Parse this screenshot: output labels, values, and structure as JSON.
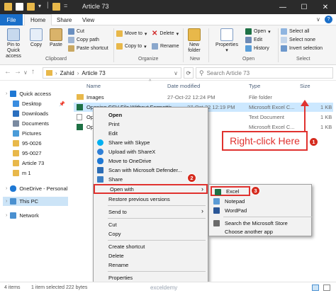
{
  "window": {
    "title": "Article 73",
    "controls": {
      "minimize": "—",
      "maximize": "☐",
      "close": "✕"
    }
  },
  "ribbon_tabs": [
    "File",
    "Home",
    "Share",
    "View"
  ],
  "ribbon": {
    "clipboard": {
      "pin": "Pin to Quick access",
      "copy": "Copy",
      "paste": "Paste",
      "cut": "Cut",
      "copy_path": "Copy path",
      "paste_shortcut": "Paste shortcut",
      "label": "Clipboard"
    },
    "organize": {
      "move_to": "Move to",
      "copy_to": "Copy to",
      "delete": "Delete",
      "rename": "Rename",
      "label": "Organize"
    },
    "new": {
      "new_folder": "New folder",
      "label": "New"
    },
    "open": {
      "properties": "Properties",
      "open": "Open",
      "edit": "Edit",
      "history": "History",
      "label": "Open"
    },
    "select": {
      "select_all": "Select all",
      "select_none": "Select none",
      "invert_selection": "Invert selection",
      "label": "Select"
    }
  },
  "address": {
    "path": [
      "Zahid",
      "Article 73"
    ],
    "search_placeholder": "Search Article 73"
  },
  "nav_pane": [
    {
      "label": "Quick access",
      "color": "#1e78d4"
    },
    {
      "label": "Desktop",
      "color": "#3a8de0"
    },
    {
      "label": "Downloads",
      "color": "#2a6fbf"
    },
    {
      "label": "Documents",
      "color": "#7a8aa0"
    },
    {
      "label": "Pictures",
      "color": "#4a9bd8"
    },
    {
      "label": "95-0026",
      "color": "#e8b84a"
    },
    {
      "label": "95-0027",
      "color": "#e8b84a"
    },
    {
      "label": "Article 73",
      "color": "#e8b84a"
    },
    {
      "label": "m 1",
      "color": "#e8b84a"
    },
    {
      "label": "OneDrive - Personal",
      "color": "#1e78d4"
    },
    {
      "label": "This PC",
      "color": "#4a90d0"
    },
    {
      "label": "Network",
      "color": "#4a90d0"
    }
  ],
  "columns": {
    "name": "Name",
    "date": "Date modified",
    "type": "Type",
    "size": "Size"
  },
  "files": [
    {
      "name": "Images",
      "date": "27-Oct-22 12:24 PM",
      "type": "File folder",
      "size": "",
      "icon": "#e8b84a"
    },
    {
      "name": "Opening CSV File Without Formatting",
      "date": "27-Oct-22 12:19 PM",
      "type": "Microsoft Excel C...",
      "size": "1 KB",
      "icon": "#1e7145"
    },
    {
      "name": "Openi",
      "date": "",
      "type": "Text Document",
      "size": "1 KB",
      "icon": "#9a9a9a"
    },
    {
      "name": "Openi",
      "date": "",
      "type": "Microsoft Excel C...",
      "size": "1 KB",
      "icon": "#1e7145"
    }
  ],
  "context_menu": [
    {
      "label": "Open",
      "bold": true,
      "icon": ""
    },
    {
      "label": "Print",
      "icon": ""
    },
    {
      "label": "Edit",
      "icon": ""
    },
    {
      "label": "Share with Skype",
      "icon": "#00aff0"
    },
    {
      "label": "Upload with ShareX",
      "icon": "#2e7fd6"
    },
    {
      "label": "Move to OneDrive",
      "icon": "#1e78d4"
    },
    {
      "label": "Scan with Microsoft Defender...",
      "icon": "#2d6db5"
    },
    {
      "label": "Share",
      "icon": "#3c7fc4"
    },
    {
      "label": "Open with",
      "icon": ""
    },
    {
      "label": "Restore previous versions",
      "icon": ""
    },
    {
      "label": "Send to",
      "icon": ""
    },
    {
      "label": "Cut",
      "icon": ""
    },
    {
      "label": "Copy",
      "icon": ""
    },
    {
      "label": "Create shortcut",
      "icon": ""
    },
    {
      "label": "Delete",
      "icon": ""
    },
    {
      "label": "Rename",
      "icon": ""
    },
    {
      "label": "Properties",
      "icon": ""
    }
  ],
  "submenu": [
    {
      "label": "Excel",
      "icon": "#1e7145"
    },
    {
      "label": "Notepad",
      "icon": "#5b9bd5"
    },
    {
      "label": "WordPad",
      "icon": "#2b5797"
    },
    {
      "label": "Search the Microsoft Store",
      "icon": "#6a6a6a"
    },
    {
      "label": "Choose another app",
      "icon": ""
    }
  ],
  "callout": {
    "text": "Right-click Here"
  },
  "badges": [
    "1",
    "2",
    "3"
  ],
  "status": {
    "items": "4 items",
    "selected": "1 item selected  222 bytes"
  },
  "watermark": "exceldemy",
  "colors": {
    "accent": "#e0322f",
    "selection": "#cce8ff",
    "file_tab": "#1a6fc9"
  }
}
